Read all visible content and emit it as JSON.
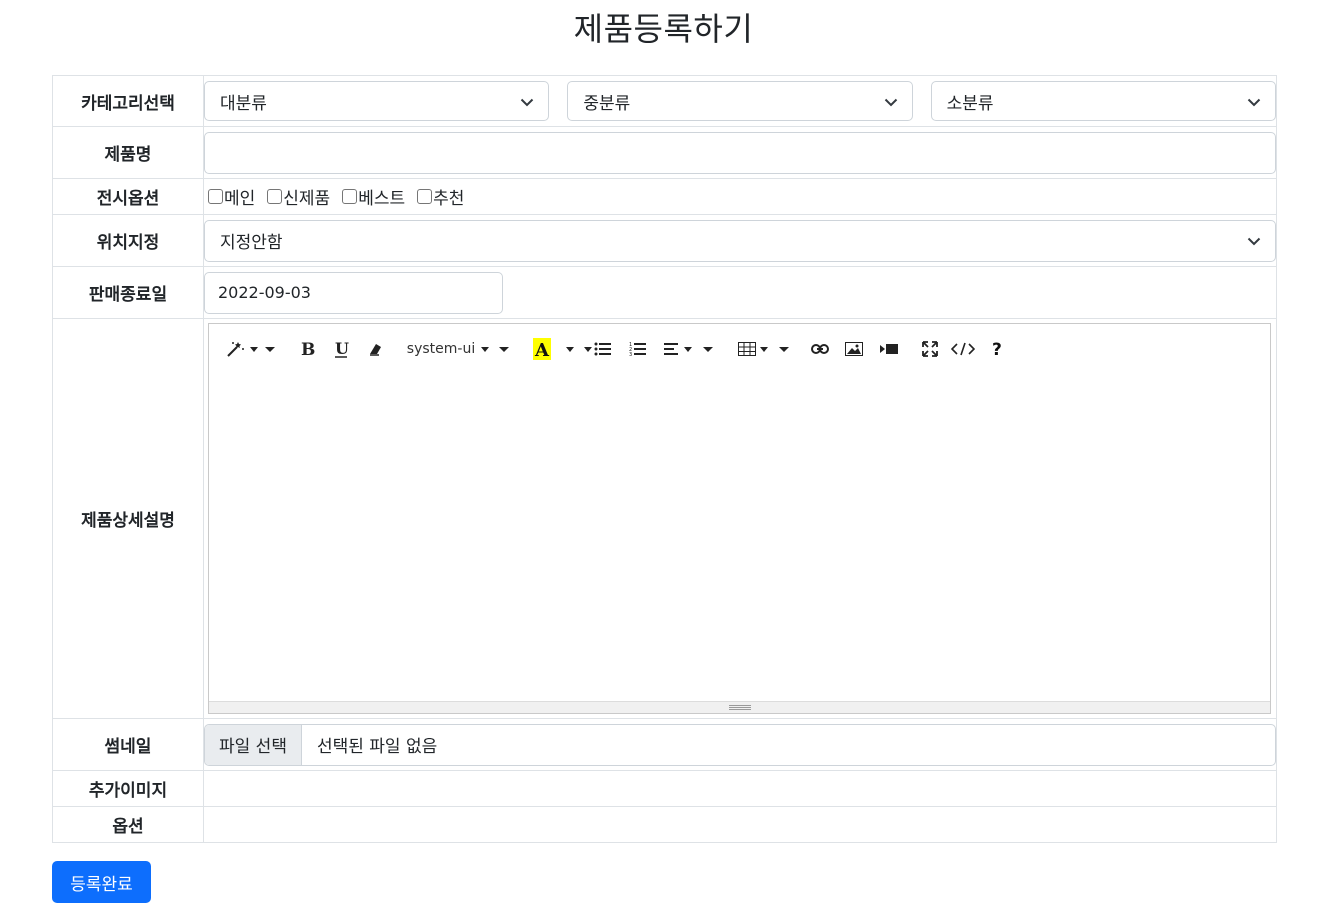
{
  "page": {
    "title": "제품등록하기"
  },
  "form": {
    "category": {
      "label": "카테고리선택",
      "major": "대분류",
      "middle": "중분류",
      "minor": "소분류"
    },
    "product_name": {
      "label": "제품명",
      "value": ""
    },
    "display_options": {
      "label": "전시옵션",
      "options": [
        "메인",
        "신제품",
        "베스트",
        "추천"
      ]
    },
    "position": {
      "label": "위치지정",
      "value": "지정안함"
    },
    "sale_end_date": {
      "label": "판매종료일",
      "value": "2022-09-03"
    },
    "description": {
      "label": "제품상세설명",
      "toolbar": {
        "font_name": "system-ui"
      },
      "content": ""
    },
    "thumbnail": {
      "label": "썸네일",
      "button": "파일 선택",
      "file_name": "선택된 파일 없음"
    },
    "extra_images": {
      "label": "추가이미지"
    },
    "options": {
      "label": "옵션"
    }
  },
  "submit": {
    "label": "등록완료"
  },
  "colors": {
    "primary": "#0d6efd",
    "border": "#dee2e6",
    "highlight": "#ffff00"
  }
}
